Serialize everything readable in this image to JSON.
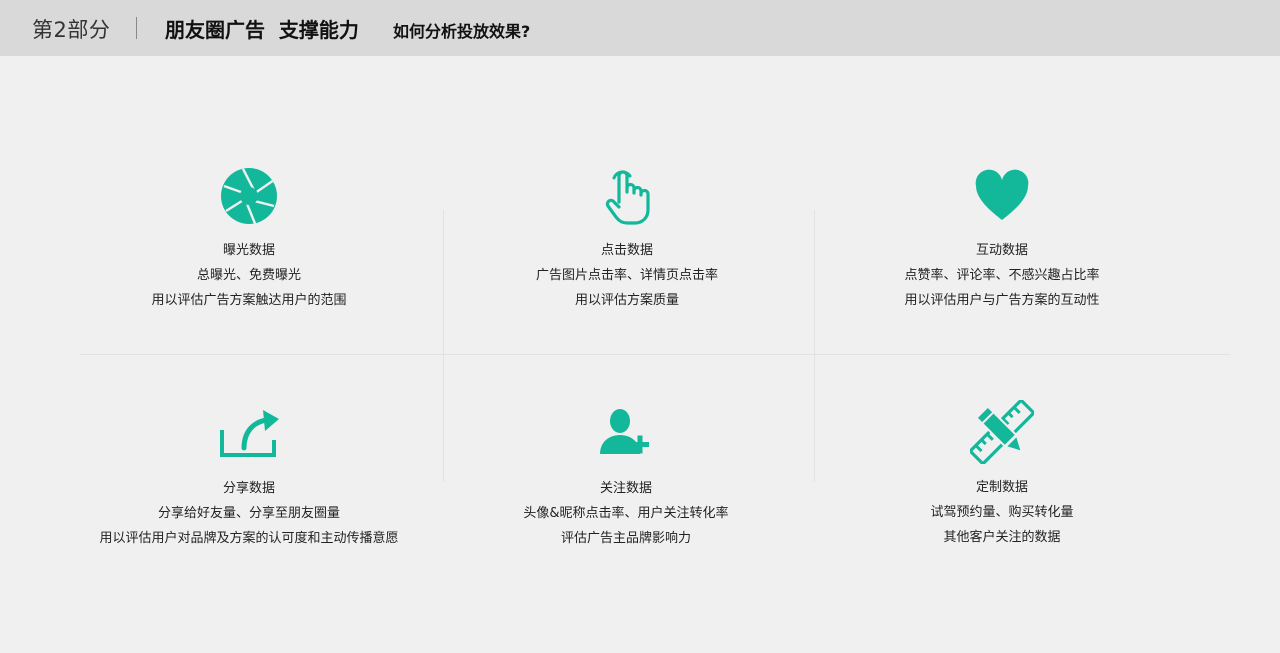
{
  "header": {
    "section": "第2部分",
    "title": "朋友圈广告  支撑能力",
    "subtitle": "如何分析投放效果?"
  },
  "colors": {
    "accent": "#13b89b",
    "header_bg": "#d9d9d9",
    "page_bg": "#f0f0f0"
  },
  "cards": [
    {
      "icon": "aperture-icon",
      "title": "曝光数据",
      "line1": "总曝光、免费曝光",
      "line2": "用以评估广告方案触达用户的范围"
    },
    {
      "icon": "tap-hand-icon",
      "title": "点击数据",
      "line1": "广告图片点击率、详情页点击率",
      "line2": "用以评估方案质量"
    },
    {
      "icon": "heart-icon",
      "title": "互动数据",
      "line1": "点赞率、评论率、不感兴趣占比率",
      "line2": "用以评估用户与广告方案的互动性"
    },
    {
      "icon": "share-icon",
      "title": "分享数据",
      "line1": "分享给好友量、分享至朋友圈量",
      "line2": "用以评估用户对品牌及方案的认可度和主动传播意愿"
    },
    {
      "icon": "add-user-icon",
      "title": "关注数据",
      "line1": "头像&昵称点击率、用户关注转化率",
      "line2": "评估广告主品牌影响力"
    },
    {
      "icon": "edit-pencil-icon",
      "title": "定制数据",
      "line1": "试驾预约量、购买转化量",
      "line2": "其他客户关注的数据"
    }
  ]
}
